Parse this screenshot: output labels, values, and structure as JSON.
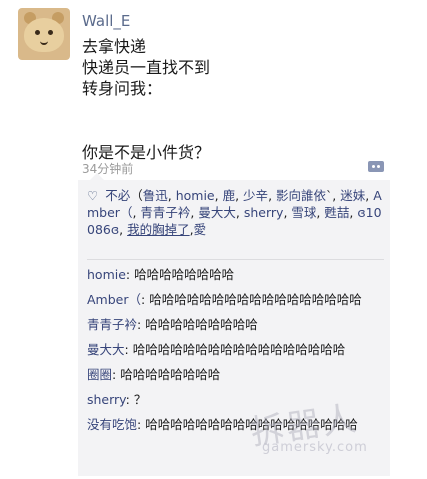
{
  "post": {
    "username": "Wall_E",
    "lines": [
      "去拿快递",
      "快递员一直找不到",
      "转身问我：",
      "你是不是小件货？"
    ],
    "time": "34分钟前"
  },
  "likes": {
    "heart": "♡",
    "segments": [
      {
        "text": "不必",
        "type": "name"
      },
      {
        "text": "（",
        "type": "plain"
      },
      {
        "text": "鲁迅",
        "type": "name"
      },
      {
        "text": ", ",
        "type": "plain"
      },
      {
        "text": "homie",
        "type": "name"
      },
      {
        "text": ", ",
        "type": "plain"
      },
      {
        "text": "鹿",
        "type": "name"
      },
      {
        "text": ", ",
        "type": "plain"
      },
      {
        "text": "少辛",
        "type": "name"
      },
      {
        "text": ", ",
        "type": "plain"
      },
      {
        "text": "影向誰依",
        "type": "name"
      },
      {
        "text": "`, ",
        "type": "plain"
      },
      {
        "text": "迷妹",
        "type": "name"
      },
      {
        "text": ", ",
        "type": "plain"
      },
      {
        "text": "Amber（",
        "type": "name"
      },
      {
        "text": ", ",
        "type": "plain"
      },
      {
        "text": "青青子衿",
        "type": "name"
      },
      {
        "text": ", ",
        "type": "plain"
      },
      {
        "text": "曼大大",
        "type": "name"
      },
      {
        "text": ", ",
        "type": "plain"
      },
      {
        "text": "sherry",
        "type": "name"
      },
      {
        "text": ", ",
        "type": "plain"
      },
      {
        "text": "雪球",
        "type": "name"
      },
      {
        "text": ", ",
        "type": "plain"
      },
      {
        "text": "甦喆",
        "type": "name"
      },
      {
        "text": ", ",
        "type": "plain"
      },
      {
        "text": "ɞ10086ɞ",
        "type": "name"
      },
      {
        "text": ", ",
        "type": "plain"
      },
      {
        "text": "我的胸掉了",
        "type": "name-underline"
      },
      {
        "text": ",",
        "type": "plain"
      },
      {
        "text": "愛",
        "type": "name"
      }
    ]
  },
  "comments": [
    {
      "name": "homie",
      "text": "哈哈哈哈哈哈哈哈"
    },
    {
      "name": "Amber（",
      "text": "哈哈哈哈哈哈哈哈哈哈哈哈哈哈哈哈哈"
    },
    {
      "name": "青青子衿",
      "text": "哈哈哈哈哈哈哈哈哈"
    },
    {
      "name": "曼大大",
      "text": "哈哈哈哈哈哈哈哈哈哈哈哈哈哈哈哈哈"
    },
    {
      "name": "圈圈",
      "text": "哈哈哈哈哈哈哈哈"
    },
    {
      "name": "sherry",
      "text": "？"
    },
    {
      "name": "没有吃饱",
      "text": "哈哈哈哈哈哈哈哈哈哈哈哈哈哈哈哈哈"
    }
  ],
  "watermark": {
    "main": "拆器人",
    "sub": "gamersky.com"
  }
}
